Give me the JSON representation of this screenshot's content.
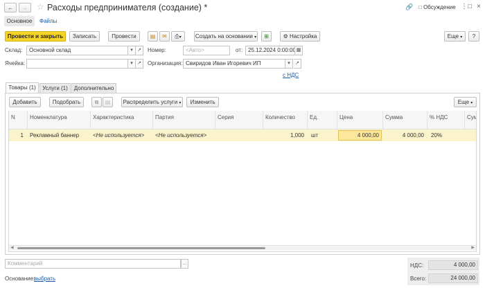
{
  "window": {
    "title": "Расходы предпринимателя (создание) *",
    "discussion_label": "Обсуждение"
  },
  "nav_tabs": [
    {
      "label": "Основное"
    },
    {
      "label": "Файлы"
    }
  ],
  "toolbar": {
    "post_close": "Провести и закрыть",
    "save": "Записать",
    "post": "Провести",
    "create_based": "Создать на основании",
    "settings": "Настройка",
    "more": "Еще",
    "help": "?"
  },
  "form": {
    "warehouse_label": "Склад:",
    "warehouse_value": "Основной склад",
    "number_label": "Номер:",
    "number_placeholder": "<Авто>",
    "date_label": "от:",
    "date_value": "25.12.2024  0:00:00",
    "cell_label": "Ячейка:",
    "org_label": "Организация:",
    "org_value": "Свиридов Иван Игоревич ИП",
    "vat_link": "с НДС"
  },
  "inner_tabs": [
    {
      "label": "Товары (1)"
    },
    {
      "label": "Услуги (1)"
    },
    {
      "label": "Дополнительно"
    }
  ],
  "table_toolbar": {
    "add": "Добавить",
    "pick": "Подобрать",
    "distribute": "Распределить услуги",
    "change": "Изменить",
    "more": "Еще"
  },
  "table": {
    "columns": [
      "N",
      "Номенклатура",
      "Характеристика",
      "Партия",
      "Серия",
      "Количество",
      "Ед.",
      "Цена",
      "Сумма",
      "% НДС",
      "Сум"
    ],
    "rows": [
      {
        "n": "1",
        "nomenclature": "Рекламный баннер",
        "characteristic": "<Не используется>",
        "batch": "<Не используется>",
        "series": "",
        "quantity": "1,000",
        "unit": "шт",
        "price": "4 000,00",
        "sum": "4 000,00",
        "vat_rate": "20%"
      }
    ]
  },
  "footer": {
    "comment_placeholder": "Комментарий",
    "basis_label": "Основание:",
    "basis_link": "выбрать",
    "vat_label": "НДС:",
    "vat_value": "4 000,00",
    "total_label": "Всего:",
    "total_value": "24 000,00"
  },
  "colors": {
    "primary_button": "#f5d329",
    "selected_row": "#fbf3cc",
    "link": "#1a5aa6"
  }
}
